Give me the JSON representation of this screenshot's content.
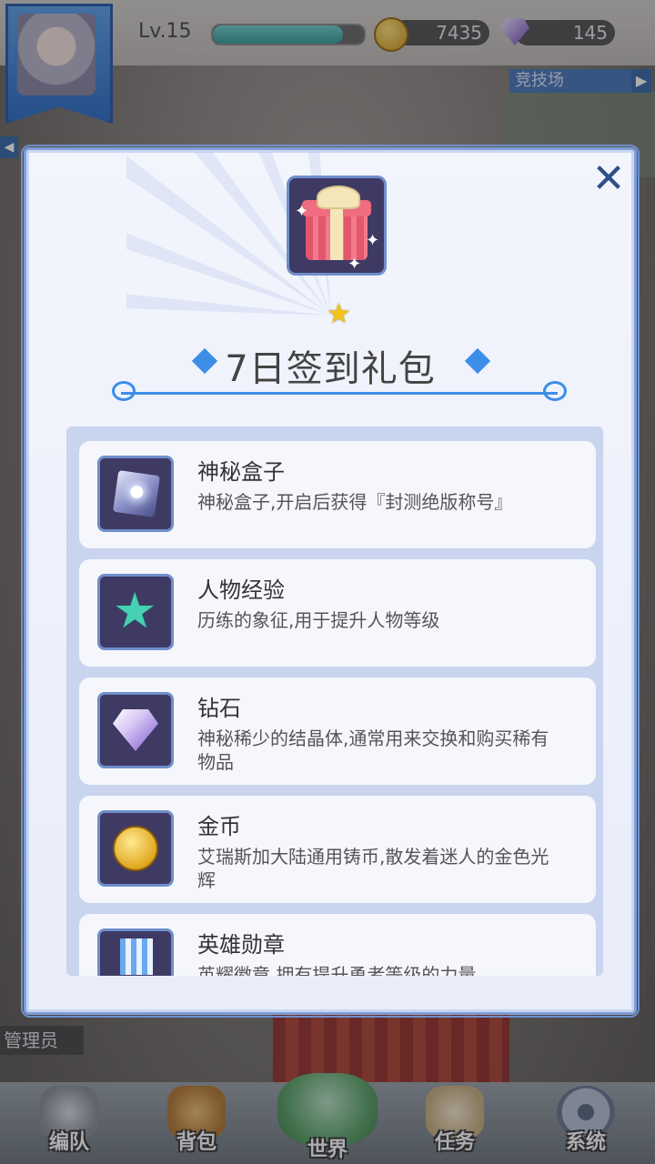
{
  "hud": {
    "level": "Lv.15",
    "xp_progress": 0.86,
    "coins": "7435",
    "gems": "145",
    "arena_label": "竞技场",
    "arena_arrow": "▶",
    "left_arrow": "◀",
    "admin_label": "管理员"
  },
  "modal": {
    "title": "7日签到礼包",
    "close_glyph": "✕",
    "star_glyph": "★",
    "items": [
      {
        "name": "神秘盒子",
        "desc": "神秘盒子,开启后获得『封测绝版称号』",
        "icon": "mystery-box-icon"
      },
      {
        "name": "人物经验",
        "desc": "历练的象征,用于提升人物等级",
        "icon": "exp-star-icon"
      },
      {
        "name": "钻石",
        "desc": "神秘稀少的结晶体,通常用来交换和购买稀有物品",
        "icon": "diamond-icon"
      },
      {
        "name": "金币",
        "desc": "艾瑞斯加大陆通用铸币,散发着迷人的金色光辉",
        "icon": "gold-coin-icon"
      },
      {
        "name": "英雄勋章",
        "desc": "英耀徽章,拥有提升勇者等级的力量",
        "icon": "hero-medal-icon"
      }
    ]
  },
  "nav": {
    "items": [
      {
        "label": "编队",
        "icon": "helmet-icon"
      },
      {
        "label": "背包",
        "icon": "backpack-icon"
      },
      {
        "label": "世界",
        "icon": "world-island-icon"
      },
      {
        "label": "任务",
        "icon": "scroll-icon"
      },
      {
        "label": "系统",
        "icon": "gear-icon"
      }
    ]
  },
  "colors": {
    "accent": "#3c8ee8",
    "panel_border": "#6f8fcc",
    "icon_frame": "#3f3a63",
    "star": "#f2c21a"
  }
}
